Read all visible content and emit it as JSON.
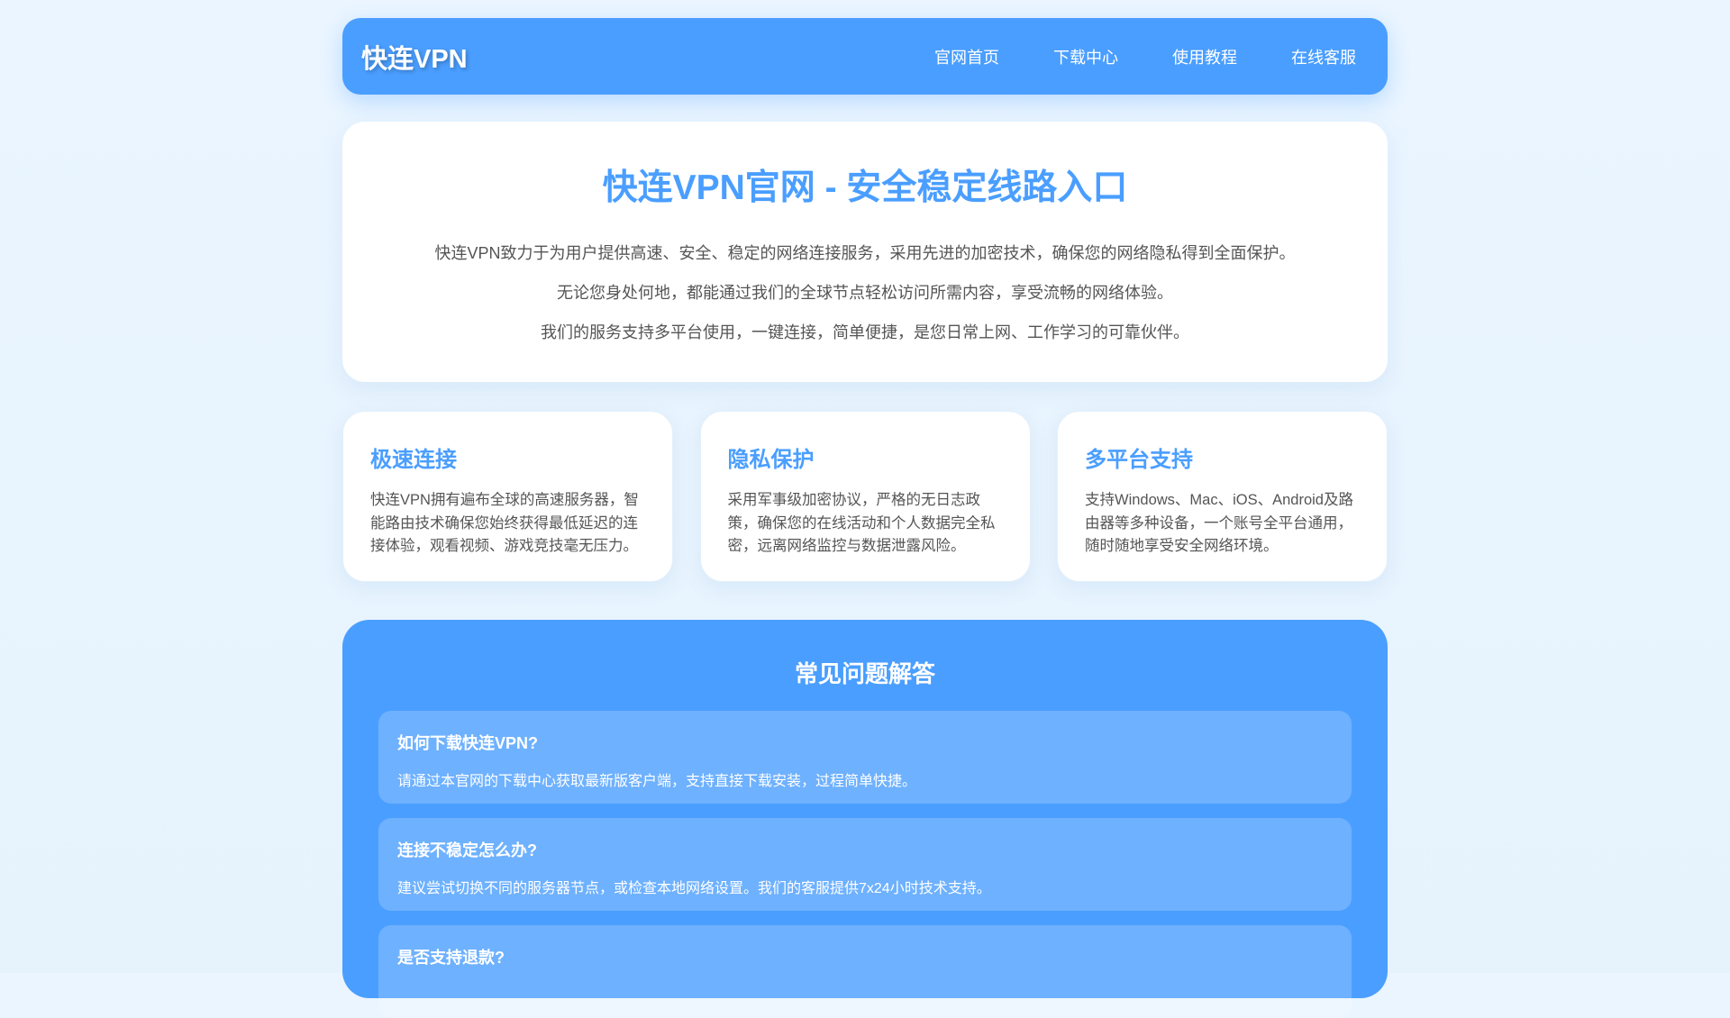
{
  "header": {
    "logo": "快连VPN",
    "nav": [
      "官网首页",
      "下载中心",
      "使用教程",
      "在线客服"
    ]
  },
  "hero": {
    "title": "快连VPN官网 - 安全稳定线路入口",
    "paragraphs": [
      "快连VPN致力于为用户提供高速、安全、稳定的网络连接服务，采用先进的加密技术，确保您的网络隐私得到全面保护。",
      "无论您身处何地，都能通过我们的全球节点轻松访问所需内容，享受流畅的网络体验。",
      "我们的服务支持多平台使用，一键连接，简单便捷，是您日常上网、工作学习的可靠伙伴。"
    ]
  },
  "features": [
    {
      "title": "极速连接",
      "text": "快连VPN拥有遍布全球的高速服务器，智能路由技术确保您始终获得最低延迟的连接体验，观看视频、游戏竞技毫无压力。"
    },
    {
      "title": "隐私保护",
      "text": "采用军事级加密协议，严格的无日志政策，确保您的在线活动和个人数据完全私密，远离网络监控与数据泄露风险。"
    },
    {
      "title": "多平台支持",
      "text": "支持Windows、Mac、iOS、Android及路由器等多种设备，一个账号全平台通用，随时随地享受安全网络环境。"
    }
  ],
  "faq": {
    "title": "常见问题解答",
    "items": [
      {
        "q": "如何下载快连VPN?",
        "a": "请通过本官网的下载中心获取最新版客户端，支持直接下载安装，过程简单快捷。"
      },
      {
        "q": "连接不稳定怎么办?",
        "a": "建议尝试切换不同的服务器节点，或检查本地网络设置。我们的客服提供7x24小时技术支持。"
      },
      {
        "q": "是否支持退款?",
        "a": ""
      }
    ]
  },
  "colors": {
    "accent": "#4a9eff",
    "background": "#eaf5ff"
  }
}
